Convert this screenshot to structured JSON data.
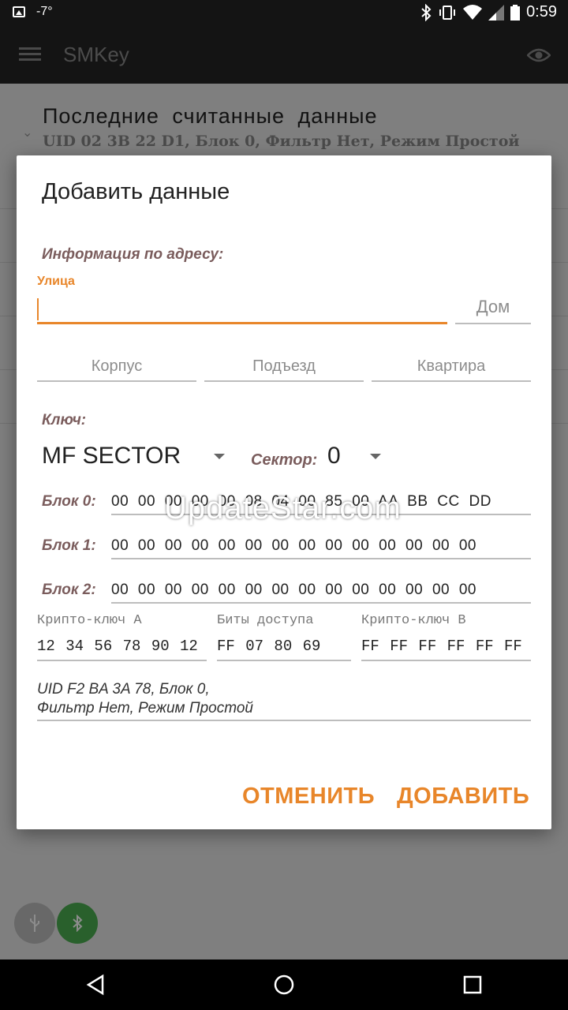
{
  "statusbar": {
    "temperature": "-7°",
    "time": "0:59"
  },
  "appbar": {
    "title": "SMKey"
  },
  "background": {
    "section_title": "Последние считанные данные",
    "section_subtitle": "UID 02 3B 22 D1, Блок 0, Фильтр Нет, Режим Простой"
  },
  "dialog": {
    "title": "Добавить данные",
    "address_heading": "Информация по адресу:",
    "street_label": "Улица",
    "street_value": "",
    "house_placeholder": "Дом",
    "building_placeholder": "Корпус",
    "entrance_placeholder": "Подъезд",
    "apartment_placeholder": "Квартира",
    "key_heading": "Ключ:",
    "key_type": "MF SECTOR",
    "sector_label": "Сектор:",
    "sector_value": "0",
    "blocks": [
      {
        "label": "Блок 0:",
        "value": "00 00 00 00 00 08 04 00 85 00 AA BB CC DD"
      },
      {
        "label": "Блок 1:",
        "value": "00 00 00 00 00 00 00 00 00 00 00 00 00 00"
      },
      {
        "label": "Блок 2:",
        "value": "00 00 00 00 00 00 00 00 00 00 00 00 00 00"
      }
    ],
    "crypto_a_label": "Крипто-ключ А",
    "crypto_a_value": "12 34 56 78 90 12",
    "access_bits_label": "Биты доступа",
    "access_bits_value": "FF 07 80 69",
    "crypto_b_label": "Крипто-ключ В",
    "crypto_b_value": "FF FF FF FF FF FF",
    "uid_line1": "UID F2 BA 3A 78, Блок 0,",
    "uid_line2": "Фильтр Нет, Режим Простой",
    "cancel_label": "ОТМЕНИТЬ",
    "add_label": "ДОБАВИТЬ"
  },
  "watermark": "UpdateStar.com",
  "colors": {
    "accent": "#e8862a",
    "label_brown": "#7a5c5c",
    "fab_green": "#4caf50"
  }
}
